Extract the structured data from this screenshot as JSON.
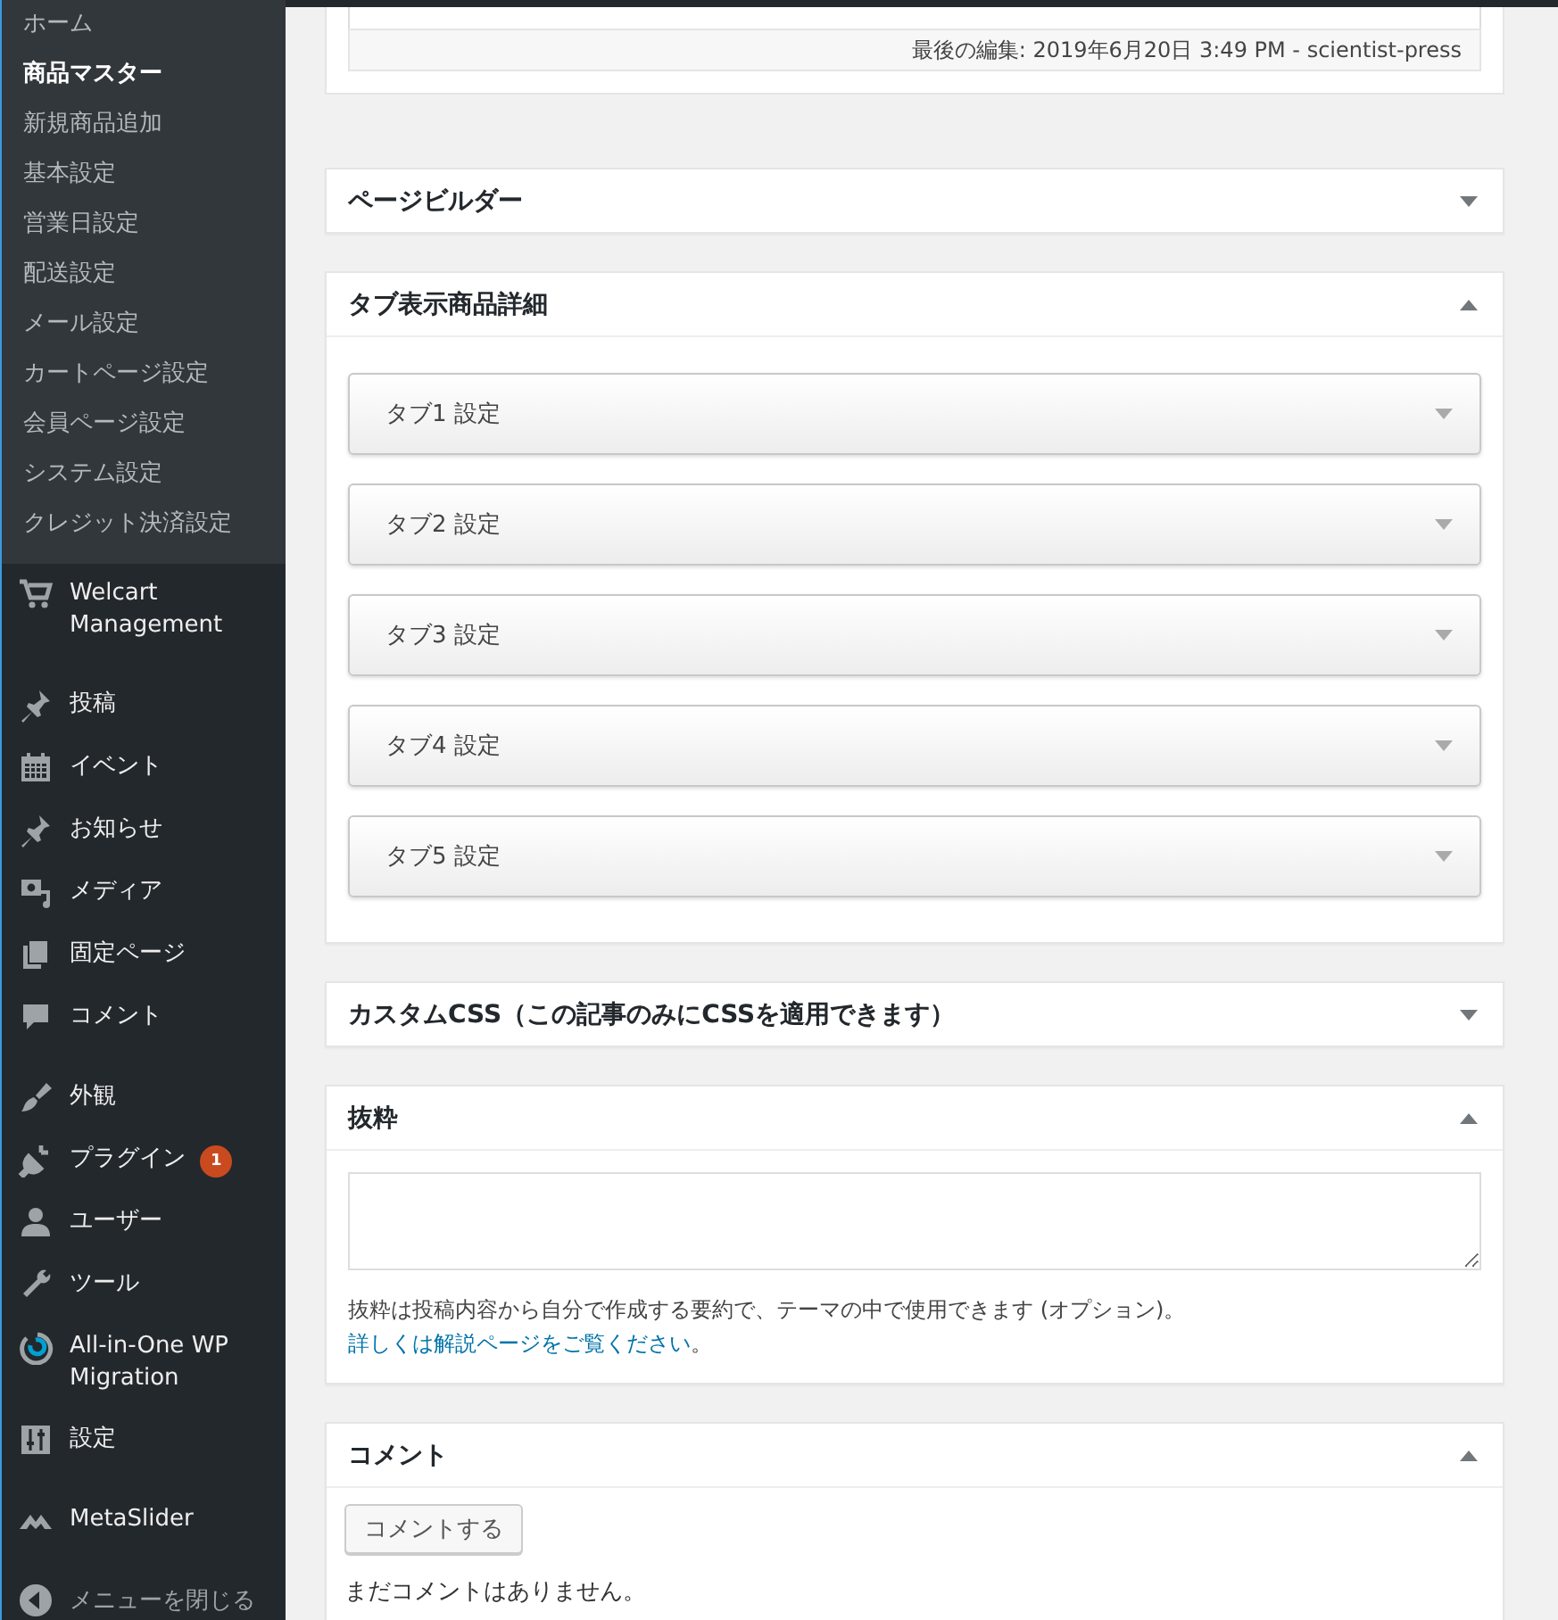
{
  "sidebar": {
    "submenu": [
      {
        "label": "ホーム",
        "selected": false
      },
      {
        "label": "商品マスター",
        "selected": true
      },
      {
        "label": "新規商品追加",
        "selected": false
      },
      {
        "label": "基本設定",
        "selected": false
      },
      {
        "label": "営業日設定",
        "selected": false
      },
      {
        "label": "配送設定",
        "selected": false
      },
      {
        "label": "メール設定",
        "selected": false
      },
      {
        "label": "カートページ設定",
        "selected": false
      },
      {
        "label": "会員ページ設定",
        "selected": false
      },
      {
        "label": "システム設定",
        "selected": false
      },
      {
        "label": "クレジット決済設定",
        "selected": false
      }
    ],
    "menu_groups": [
      [
        {
          "label": "Welcart Management",
          "kind": "cart"
        }
      ],
      [
        {
          "label": "投稿",
          "kind": "pin"
        },
        {
          "label": "イベント",
          "kind": "calendar"
        },
        {
          "label": "お知らせ",
          "kind": "pin"
        },
        {
          "label": "メディア",
          "kind": "media"
        },
        {
          "label": "固定ページ",
          "kind": "pages"
        },
        {
          "label": "コメント",
          "kind": "bubble"
        }
      ],
      [
        {
          "label": "外観",
          "kind": "brush"
        },
        {
          "label": "プラグイン",
          "kind": "plug",
          "badge": "1"
        },
        {
          "label": "ユーザー",
          "kind": "user"
        },
        {
          "label": "ツール",
          "kind": "wrench"
        },
        {
          "label": "All-in-One WP Migration",
          "kind": "migrate"
        },
        {
          "label": "設定",
          "kind": "sliders"
        }
      ],
      [
        {
          "label": "MetaSlider",
          "kind": "mountain"
        }
      ]
    ],
    "collapse": "メニューを閉じる"
  },
  "editor": {
    "last_edited": "最後の編集: 2019年6月20日 3:49 PM - scientist-press"
  },
  "boxes": [
    {
      "title": "ページビルダー",
      "expanded": false
    },
    {
      "kind": "tabs",
      "title": "タブ表示商品詳細",
      "expanded": true,
      "tabs": [
        {
          "label": "タブ1 設定",
          "expanded": false
        },
        {
          "label": "タブ2 設定",
          "expanded": false
        },
        {
          "label": "タブ3 設定",
          "expanded": false
        },
        {
          "label": "タブ4 設定",
          "expanded": false
        },
        {
          "label": "タブ5 設定",
          "expanded": false
        }
      ]
    },
    {
      "title": "カスタムCSS（この記事のみにCSSを適用できます）",
      "expanded": false
    },
    {
      "kind": "excerpt",
      "title": "抜粋",
      "expanded": true,
      "hint": "抜粋は投稿内容から自分で作成する要約で、テーマの中で使用できます (オプション)。",
      "link": "詳しくは解説ページをご覧ください",
      "tail": "。"
    },
    {
      "kind": "comments",
      "title": "コメント",
      "expanded": true,
      "button": "コメントする",
      "empty": "まだコメントはありません。"
    }
  ]
}
